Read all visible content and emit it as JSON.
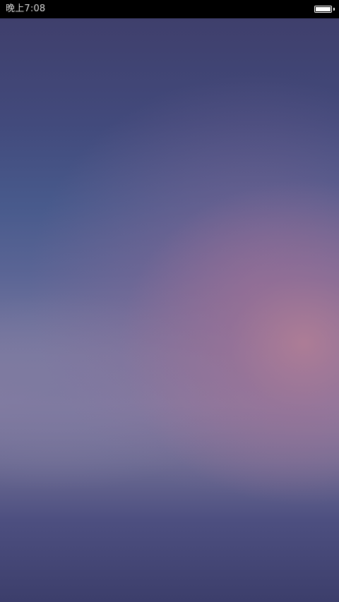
{
  "status_bar": {
    "time": "晚上7:08",
    "battery_icon": "battery-full-icon",
    "background_color": "#000000",
    "text_color": "#d8d8d8"
  },
  "wallpaper": {
    "colors": [
      "#3f3f6c",
      "#485a8c",
      "#a87f99",
      "#857fa2",
      "#3c3e6b"
    ]
  }
}
